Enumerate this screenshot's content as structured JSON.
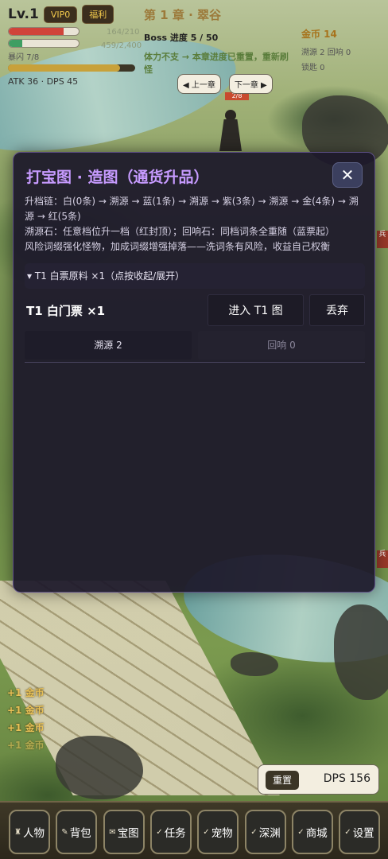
{
  "hud": {
    "level": "Lv.1",
    "vip": "VIP0",
    "welfare": "福利",
    "hp_text": "164/210",
    "hp_ratio": 0.78,
    "mp_text": "459/2,400",
    "mp_ratio": 0.19,
    "dodge": "暴闪 7/8",
    "xp_ratio": 0.88,
    "atk_dps": "ATK 36 · DPS 45",
    "chapter": "第 1 章 · 翠谷",
    "boss_progress": "Boss 进度 5 / 50",
    "warning": "体力不支 → 本章进度已重置，重新刷怪",
    "gold": "金币 14",
    "resources": "溯源 2  回响 0",
    "lock": "锁匙 0",
    "prev_chapter": "◀ 上一章",
    "next_chapter": "下一章 ▶"
  },
  "map": {
    "hero_hp": "2/8",
    "side_tag_1": "兵",
    "side_tag_2": "兵"
  },
  "modal": {
    "title": "打宝图 · 造图（通货升品）",
    "close": "✕",
    "desc_1": "升档链：白(0条) → 溯源 → 蓝(1条) → 溯源 → 紫(3条) → 溯源 → 金(4条) → 溯源 → 红(5条)",
    "desc_2": "溯源石：任意档位升一档（红封顶）；回响石：同档词条全重随（蓝票起）",
    "desc_3": "风险词缀强化怪物，加成词缀增强掉落——洗词条有风险，收益自己权衡",
    "collapse": "▾ T1 白票原料 ×1（点按收起/展开）",
    "ticket_name": "T1 白门票 ×1",
    "enter": "进入 T1 图",
    "discard": "丢弃",
    "stone_a": "溯源 2",
    "stone_b": "回响 0"
  },
  "floats": [
    "+1 金币",
    "+1 金币",
    "+1 金币",
    "+1 金币"
  ],
  "dps_panel": {
    "reset": "重置",
    "dps": "DPS 156"
  },
  "nav": [
    {
      "icon": "figure-icon",
      "glyph": "♜",
      "label": "人物"
    },
    {
      "icon": "bag-icon",
      "glyph": "✎",
      "label": "背包"
    },
    {
      "icon": "map-icon",
      "glyph": "✉",
      "label": "宝图"
    },
    {
      "icon": "task-icon",
      "glyph": "✓",
      "label": "任务"
    },
    {
      "icon": "pet-icon",
      "glyph": "✓",
      "label": "宠物"
    },
    {
      "icon": "abyss-icon",
      "glyph": "✓",
      "label": "深渊"
    },
    {
      "icon": "shop-icon",
      "glyph": "✓",
      "label": "商城"
    },
    {
      "icon": "settings-icon",
      "glyph": "✓",
      "label": "设置"
    }
  ],
  "colors": {
    "accent": "#c79bff",
    "gold": "#a7731c",
    "hp": "#d0443a",
    "mp": "#3e9e62"
  }
}
